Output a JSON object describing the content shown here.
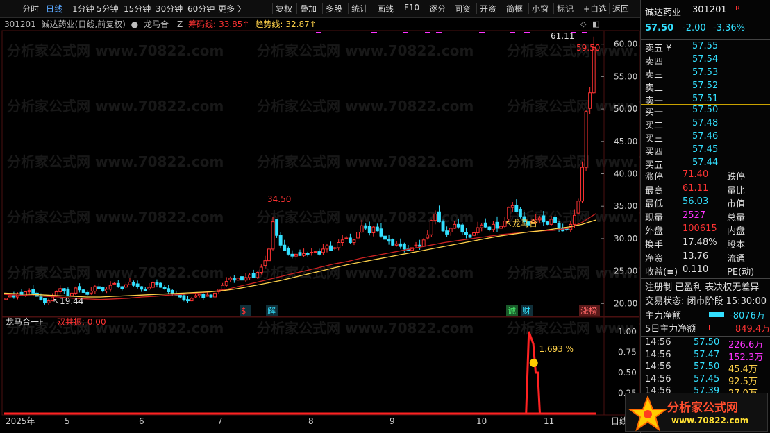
{
  "toolbar": {
    "left_items": [
      "分时",
      "日线",
      "1分钟",
      "5分钟",
      "15分钟",
      "30分钟",
      "60分钟",
      "更多 〉"
    ],
    "active": "日线",
    "right_items": [
      "复权",
      "叠加",
      "多股",
      "统计",
      "画线",
      "F10",
      "逐分",
      "同资",
      "开资",
      "简框",
      "小窗",
      "标记",
      "+自选",
      "返回"
    ]
  },
  "chart_header": {
    "code": "301201",
    "name": "诚达药业(日线,前复权)",
    "indicator": "龙马合一Z",
    "chip_label": "筹码线:",
    "chip_value": "33.85↑",
    "trend_label": "趋势线:",
    "trend_value": "32.87↑"
  },
  "price_axis": [
    "60.00",
    "55.00",
    "50.00",
    "45.00",
    "40.00",
    "35.00",
    "30.00",
    "25.00",
    "20.00"
  ],
  "annotations": {
    "high_label": "61.11",
    "close_label": "59.50",
    "peak_label": "34.50",
    "low_label": "19.44",
    "signal_label": "龙马合一"
  },
  "event_markers": [
    "$",
    "解",
    "诚",
    "财",
    "涨榜"
  ],
  "sub_chart": {
    "name": "龙马合一F",
    "label": "双共振:",
    "value": "0.00",
    "axis": [
      "1.00",
      "0.75",
      "0.50",
      "0.25"
    ],
    "peak_label": "1.693 %"
  },
  "date_axis": [
    "2025年",
    "5",
    "6",
    "7",
    "8",
    "9",
    "10",
    "11"
  ],
  "date_axis_right": "日线",
  "chart_data": {
    "type": "candlestick",
    "x_months": [
      "2025-04",
      "2025-05",
      "2025-06",
      "2025-07",
      "2025-08",
      "2025-09",
      "2025-10",
      "2025-11"
    ],
    "ylim": [
      18,
      62
    ],
    "close": [
      20.8,
      21.2,
      21.0,
      21.5,
      21.2,
      21.8,
      22.0,
      21.6,
      21.1,
      20.6,
      20.1,
      20.4,
      21.0,
      21.8,
      22.3,
      21.9,
      21.2,
      21.6,
      22.4,
      22.1,
      21.7,
      21.4,
      21.9,
      22.6,
      22.3,
      21.9,
      22.2,
      22.8,
      23.1,
      22.6,
      22.3,
      22.9,
      23.3,
      22.8,
      22.6,
      22.2,
      22.0,
      22.5,
      23.2,
      22.9,
      22.5,
      22.3,
      21.8,
      21.5,
      21.3,
      21.0,
      20.6,
      20.4,
      20.8,
      21.2,
      21.4,
      20.9,
      21.3,
      21.0,
      21.6,
      22.2,
      22.8,
      23.4,
      23.9,
      23.6,
      23.9,
      23.6,
      24.0,
      24.4,
      24.0,
      24.8,
      25.6,
      26.6,
      28.4,
      32.6,
      30.5,
      29.0,
      28.2,
      27.6,
      27.3,
      27.6,
      27.4,
      27.7,
      27.6,
      27.9,
      28.0,
      27.6,
      28.4,
      28.9,
      28.2,
      28.6,
      29.4,
      29.8,
      30.1,
      29.4,
      29.8,
      31.0,
      32.0,
      31.6,
      30.9,
      31.8,
      31.2,
      30.4,
      29.9,
      29.6,
      29.0,
      29.2,
      28.8,
      28.4,
      28.2,
      28.6,
      29.0,
      28.8,
      29.8,
      30.6,
      32.8,
      33.8,
      32.6,
      31.2,
      30.7,
      31.6,
      32.2,
      31.8,
      31.0,
      30.6,
      30.2,
      30.9,
      31.7,
      32.1,
      31.8,
      31.4,
      32.2,
      31.6,
      31.9,
      32.7,
      34.8,
      35.1,
      34.2,
      33.4,
      32.6,
      32.1,
      32.5,
      32.9,
      33.2,
      32.6,
      32.2,
      33.0,
      32.4,
      31.6,
      31.2,
      31.4,
      32.2,
      33.6,
      35.8,
      41.0,
      49.6,
      52.5,
      59.5
    ],
    "trend_line": [
      21.6,
      21.5,
      21.4,
      21.3,
      21.2,
      21.1,
      21.0,
      21.0,
      21.1,
      21.2,
      21.3,
      21.4,
      21.5,
      21.6,
      21.7,
      21.8,
      22.0,
      22.3,
      22.7,
      23.1,
      23.5,
      24.0,
      24.5,
      25.0,
      25.5,
      26.0,
      26.4,
      26.8,
      27.2,
      27.6,
      28.0,
      28.4,
      28.8,
      29.2,
      29.6,
      30.0,
      30.4,
      30.7,
      31.0,
      31.2,
      31.5,
      31.8,
      32.2,
      32.87
    ],
    "chip_line": [
      21.4,
      21.3,
      21.2,
      21.1,
      21.0,
      20.8,
      20.7,
      20.6,
      20.7,
      20.8,
      21.0,
      21.1,
      21.3,
      21.4,
      21.6,
      21.8,
      22.1,
      22.6,
      23.1,
      23.6,
      24.1,
      24.6,
      25.1,
      25.6,
      26.1,
      26.5,
      27.0,
      27.4,
      27.8,
      28.2,
      28.6,
      29.0,
      29.4,
      29.7,
      30.0,
      30.3,
      30.6,
      30.8,
      31.0,
      31.2,
      31.3,
      31.6,
      32.5,
      33.85
    ],
    "sub_series": {
      "name": "双共振",
      "spike_position": [
        0.887,
        0.902
      ],
      "spike_peak": 1.0,
      "secondary_peak": 0.5,
      "ylim": [
        0,
        1.2
      ]
    }
  },
  "quote_panel": {
    "name": "诚达药业",
    "code": "301201",
    "badge": "R",
    "price": "57.50",
    "change": "-2.00",
    "change_pct": "-3.36%",
    "asks": [
      {
        "label": "卖五 ¥",
        "price": "57.55"
      },
      {
        "label": "卖四",
        "price": "57.54"
      },
      {
        "label": "卖三",
        "price": "57.53"
      },
      {
        "label": "卖二",
        "price": "57.52"
      },
      {
        "label": "卖一",
        "price": "57.51"
      }
    ],
    "bids": [
      {
        "label": "买一",
        "price": "57.50"
      },
      {
        "label": "买二",
        "price": "57.48"
      },
      {
        "label": "买三",
        "price": "57.46"
      },
      {
        "label": "买四",
        "price": "57.45"
      },
      {
        "label": "买五",
        "price": "57.44"
      }
    ],
    "stats": [
      {
        "l": "涨停",
        "v": "71.40",
        "r": "跌停",
        "color": "#ff3333"
      },
      {
        "l": "最高",
        "v": "61.11",
        "r": "量比",
        "color": "#ff3333"
      },
      {
        "l": "最低",
        "v": "56.03",
        "r": "市值",
        "color": "#33e0ff"
      },
      {
        "l": "现量",
        "v": "2527",
        "r": "总量",
        "color": "#ff33ff"
      },
      {
        "l": "外盘",
        "v": "100615",
        "r": "内盘",
        "color": "#ff3333"
      }
    ],
    "stats2": [
      {
        "l": "换手",
        "v": "17.48%",
        "r": "股本"
      },
      {
        "l": "净资",
        "v": "13.76",
        "r": "流通"
      },
      {
        "l": "收益(≡)",
        "v": "0.110",
        "r": "PE(动)"
      }
    ],
    "tags": "注册制  已盈利  表决权无差异",
    "status": "交易状态: 闭市阶段 15:30:00",
    "main_flow_label": "主力净额",
    "main_flow_value": "-8076万",
    "flow5_label": "5日主力净额",
    "flow5_value": "849.4万",
    "ticks": [
      {
        "t": "14:56",
        "p": "57.50",
        "v": "226.6万",
        "vc": "#ff33ff"
      },
      {
        "t": "14:56",
        "p": "57.47",
        "v": "152.3万",
        "vc": "#ff33ff"
      },
      {
        "t": "14:56",
        "p": "57.50",
        "v": "45.4万",
        "vc": "#ffd24a"
      },
      {
        "t": "14:56",
        "p": "57.45",
        "v": "92.5万",
        "vc": "#ffd24a"
      },
      {
        "t": "14:56",
        "p": "57.39",
        "v": "27.0万",
        "vc": "#ffd24a"
      }
    ]
  },
  "watermark": "分析家公式网 www.70822.com",
  "logo": {
    "title": "分析家公式网",
    "url": "www.70822.com"
  },
  "colors": {
    "up": "#ff3333",
    "down": "#33e0ff",
    "trend": "#ffd24a",
    "chip": "#cc2222",
    "accent": "#5aa7ff"
  }
}
